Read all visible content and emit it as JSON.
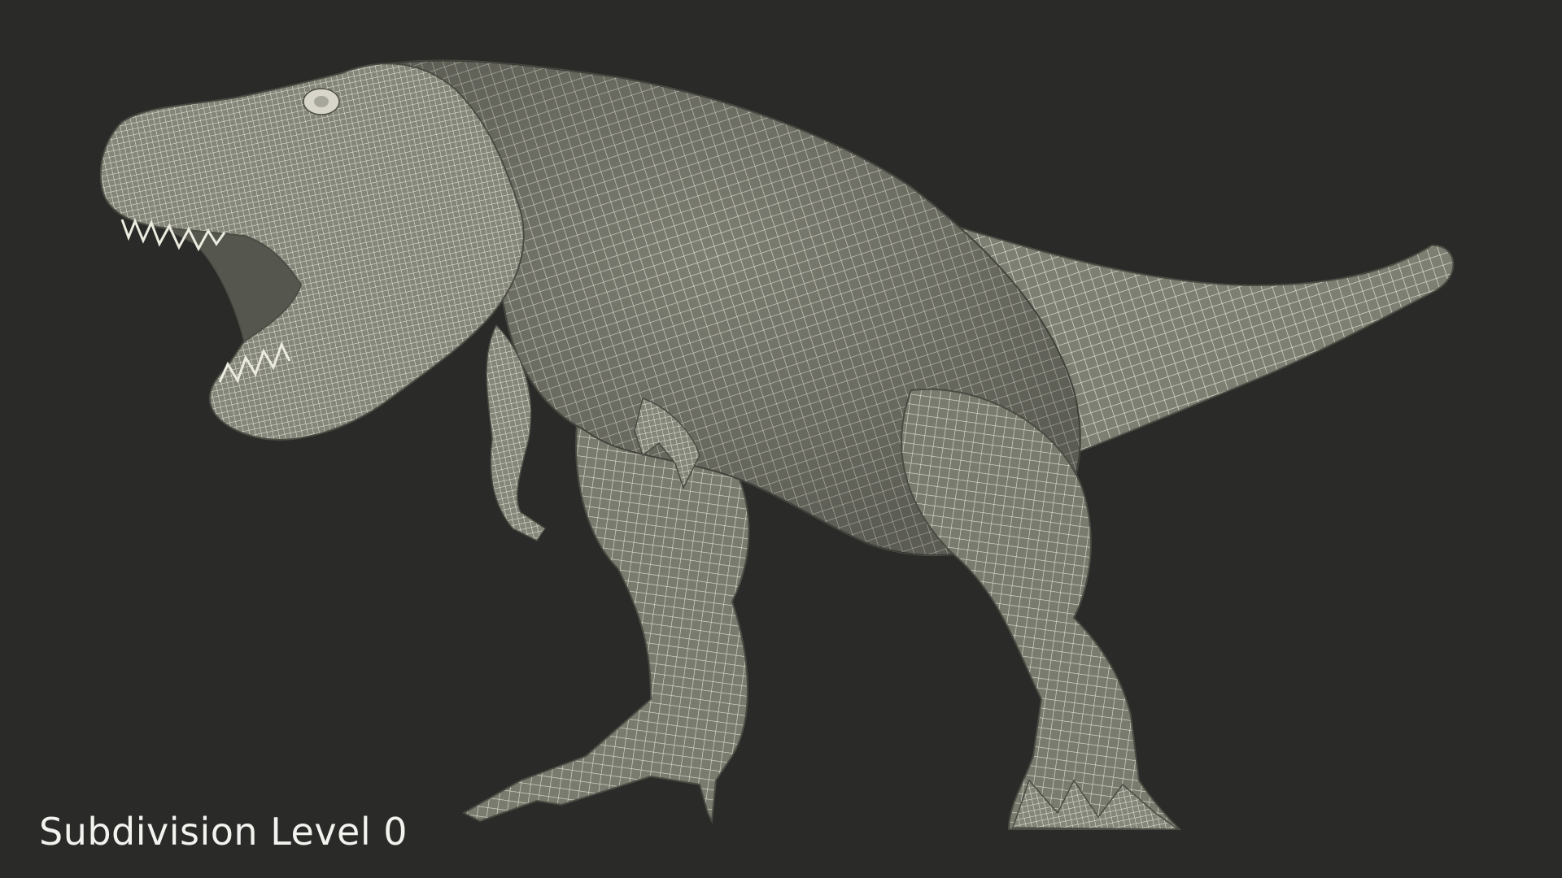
{
  "viewport": {
    "caption": "Subdivision Level 0"
  },
  "model": {
    "subject": "t-rex-wireframe",
    "surface_color": "#7e7f73",
    "wire_color": "#e6e4d8",
    "background_color": "#2a2a28"
  }
}
